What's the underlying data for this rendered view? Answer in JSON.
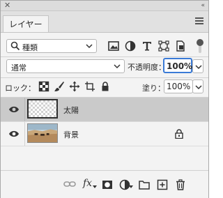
{
  "window": {
    "close_glyph": "✕",
    "collapse_glyph": "«"
  },
  "tabs": [
    {
      "label": "レイヤー"
    }
  ],
  "filter": {
    "kind_label": "種類",
    "icons": [
      "image-filter-icon",
      "adjustment-filter-icon",
      "type-filter-icon",
      "shape-filter-icon",
      "smart-object-filter-icon"
    ]
  },
  "blend": {
    "mode": "通常",
    "opacity_label": "不透明度：",
    "opacity_value": "100%"
  },
  "lock": {
    "label": "ロック：",
    "fill_label": "塗り：",
    "fill_value": "100%"
  },
  "layers": [
    {
      "name": "太陽",
      "visible": true,
      "selected": true,
      "locked": false
    },
    {
      "name": "背景",
      "visible": true,
      "selected": false,
      "locked": true
    }
  ],
  "bottom": {
    "fx_label": "fx"
  },
  "colors": {
    "panel_bg": "#f3f3f3",
    "selected_row": "#cacaca",
    "focus_blue": "#3a7ad6"
  }
}
